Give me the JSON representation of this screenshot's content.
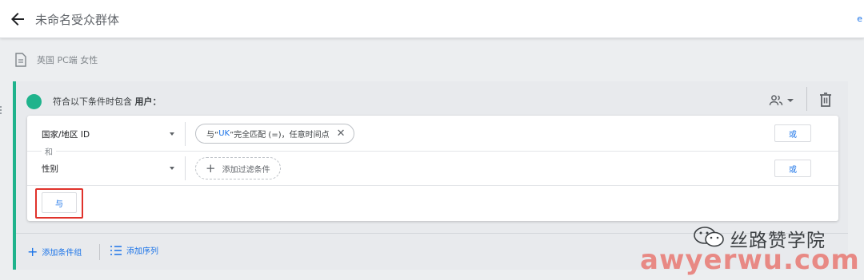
{
  "header": {
    "title": "未命名受众群体"
  },
  "description": {
    "text": "英国 PC端 女性"
  },
  "group": {
    "label_prefix": "符合以下条件时包含",
    "label_bold": "用户：",
    "accent_color": "#1fb38c",
    "conditions": [
      {
        "dimension": "国家/地区 ID",
        "chip": {
          "prefix": "与“",
          "value": "UK",
          "suffix": "”完全匹配 (=)，任意时间点"
        },
        "or_label": "或"
      },
      {
        "dimension": "性别",
        "add_filter_label": "添加过滤条件",
        "or_label": "或"
      }
    ],
    "and_divider_label": "和",
    "and_button_label": "与",
    "footer": {
      "add_condition_group": "添加条件组",
      "add_sequence": "添加序列"
    }
  },
  "watermark": {
    "name": "丝路赞学院",
    "domain": "awyerwu.com"
  },
  "icons": {
    "back": "arrow-back-icon",
    "description": "document-icon",
    "scope": "people-icon",
    "delete": "trash-icon",
    "remove_chip": "close-icon",
    "sequence": "sequence-list-icon",
    "logo": "wechat-icon"
  }
}
